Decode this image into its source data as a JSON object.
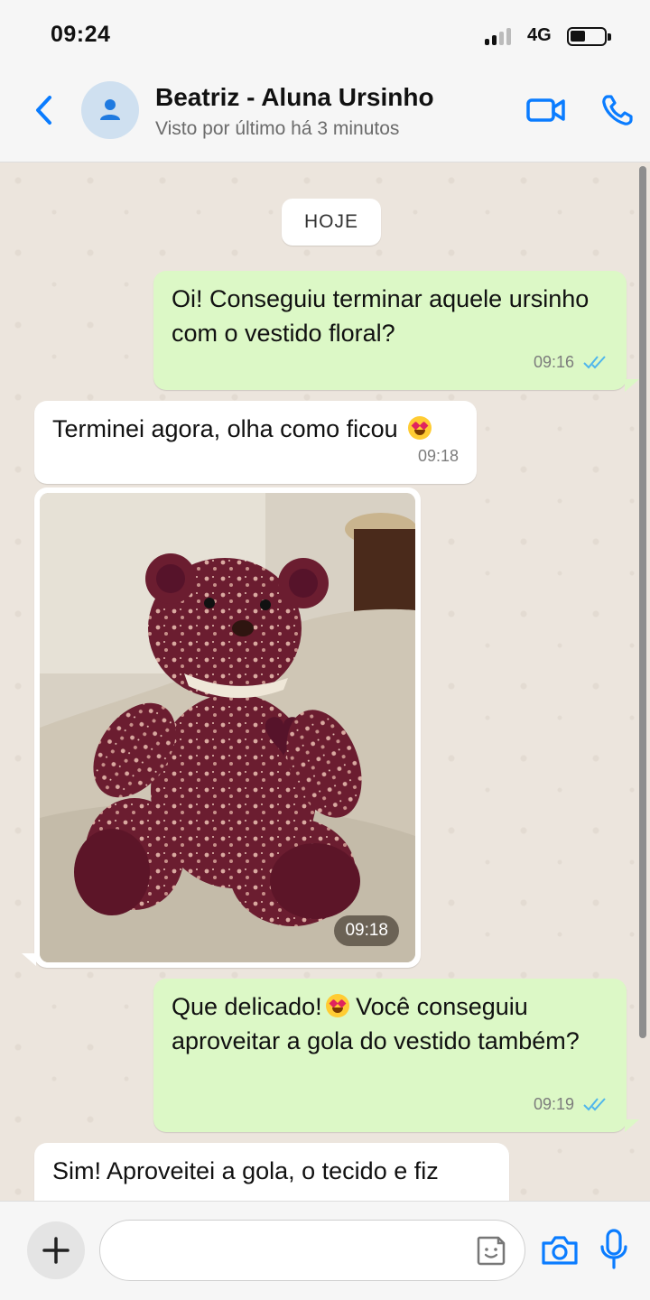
{
  "status_bar": {
    "time": "09:24",
    "network": "4G",
    "signal_bars": 2,
    "battery_level": 0.4
  },
  "header": {
    "contact_name": "Beatriz - Aluna Ursinho",
    "contact_status": "Visto por último há 3 minutos",
    "icons": [
      "back-chevron-icon",
      "avatar-person-icon",
      "video-call-icon",
      "phone-call-icon"
    ]
  },
  "chat": {
    "date_chip": "HOJE",
    "messages": [
      {
        "direction": "out",
        "text": "Oi! Conseguiu terminar aquele ursinho com o vestido floral?",
        "time": "09:16",
        "status": "read"
      },
      {
        "direction": "in",
        "text": "Terminei agora, olha como ficou",
        "time": "09:18",
        "emoji": "heart-eyes"
      },
      {
        "direction": "in",
        "type": "image",
        "time": "09:18"
      },
      {
        "direction": "out",
        "text_before": "Que delicado!",
        "text_after": " Você conseguiu aproveitar a gola do vestido também?",
        "time": "09:19",
        "status": "read",
        "emoji": "heart-eyes"
      },
      {
        "direction": "in",
        "text": "Sim! Aproveitei a gola, o tecido e fiz"
      }
    ]
  },
  "colors": {
    "accent": "#0a7cff",
    "outgoing_bubble": "#dcf8c6",
    "incoming_bubble": "#ffffff",
    "read_ticks": "#4fb6ec",
    "chat_bg": "#ece5dd"
  },
  "composer": {
    "icons": [
      "plus-icon",
      "sticker-icon",
      "camera-icon",
      "microphone-icon"
    ],
    "input_value": ""
  }
}
